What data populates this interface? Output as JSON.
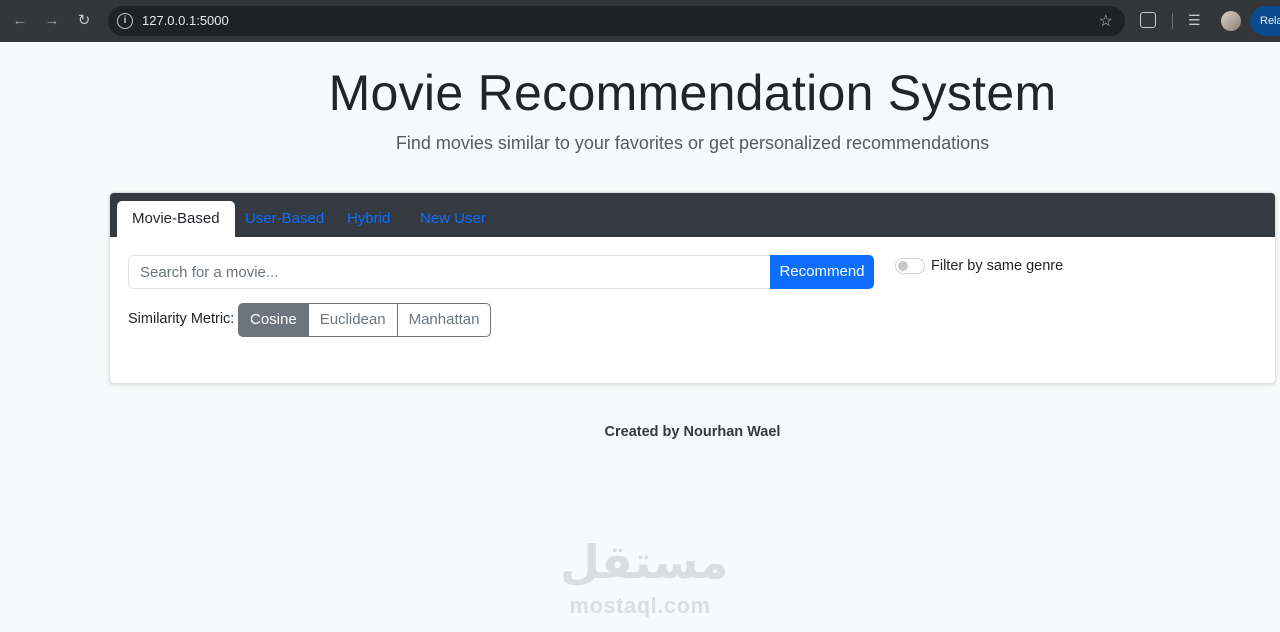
{
  "browser": {
    "url": "127.0.0.1:5000",
    "relaunch_label": "Rela"
  },
  "header": {
    "title": "Movie Recommendation System",
    "subtitle": "Find movies similar to your favorites or get personalized recommendations"
  },
  "tabs": [
    {
      "label": "Movie-Based",
      "active": true
    },
    {
      "label": "User-Based",
      "active": false
    },
    {
      "label": "Hybrid",
      "active": false
    },
    {
      "label": "New User",
      "active": false
    }
  ],
  "search": {
    "placeholder": "Search for a movie...",
    "value": "",
    "button_label": "Recommend"
  },
  "genre_filter": {
    "label": "Filter by same genre",
    "checked": false
  },
  "similarity": {
    "label": "Similarity Metric:",
    "options": [
      "Cosine",
      "Euclidean",
      "Manhattan"
    ],
    "selected": "Cosine"
  },
  "footer": {
    "credit": "Created by Nourhan Wael"
  },
  "watermark": {
    "arabic": "مستقل",
    "latin": "mostaql.com"
  },
  "colors": {
    "primary": "#0d6efd",
    "header_dark": "#343a40",
    "secondary": "#6c757d",
    "page_bg": "#f8f9fa"
  }
}
